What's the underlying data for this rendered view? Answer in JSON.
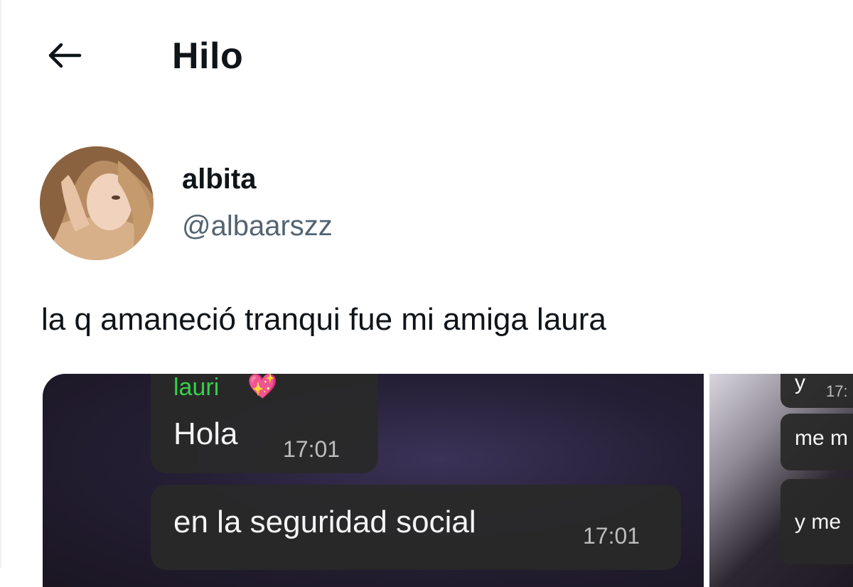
{
  "header": {
    "title": "Hilo",
    "back_icon": "arrow-left-icon"
  },
  "author": {
    "display_name": "albita",
    "handle": "@albaarszz"
  },
  "tweet": {
    "text": "la q amaneció tranqui fue mi amiga laura"
  },
  "media": {
    "left": {
      "sender": "lauri",
      "sender_emoji": "💖",
      "messages": [
        {
          "text": "Hola",
          "time": "17:01"
        },
        {
          "text": "en la seguridad social",
          "time": "17:01"
        }
      ]
    },
    "right": {
      "messages": [
        {
          "text": "y",
          "time": "17:"
        },
        {
          "text": "me m",
          "time": ""
        },
        {
          "text": "y me",
          "time": ""
        }
      ]
    }
  },
  "colors": {
    "text_primary": "#0f1419",
    "text_secondary": "#536471",
    "chat_sender": "#35d04a",
    "chat_bubble": "#292929"
  }
}
